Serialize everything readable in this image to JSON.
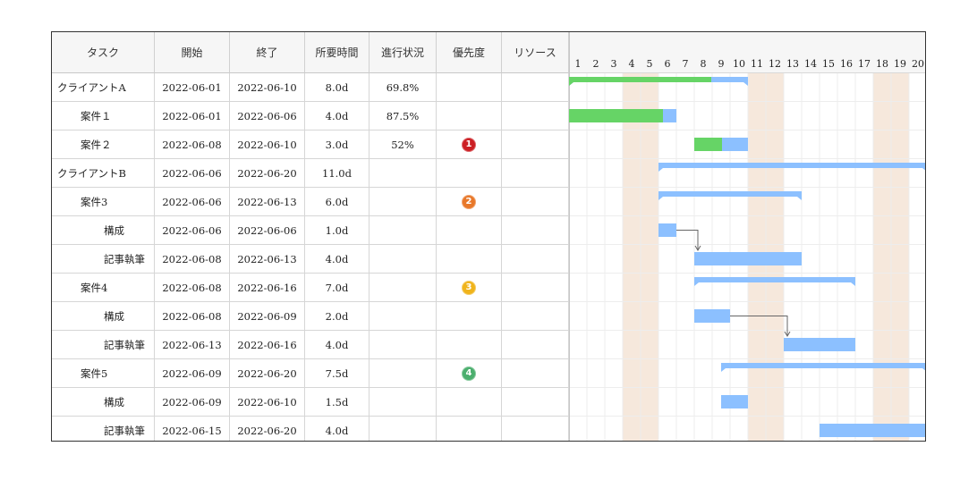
{
  "columns": {
    "task": "タスク",
    "start": "開始",
    "end": "終了",
    "duration": "所要時間",
    "progress": "進行状況",
    "priority": "優先度",
    "resource": "リソース"
  },
  "days": [
    "1",
    "2",
    "3",
    "4",
    "5",
    "6",
    "7",
    "8",
    "9",
    "10",
    "11",
    "12",
    "13",
    "14",
    "15",
    "16",
    "17",
    "18",
    "19",
    "20"
  ],
  "weekend_days": [
    4,
    5,
    11,
    12,
    18,
    19
  ],
  "priority_colors": {
    "1": "#cc1f24",
    "2": "#e8782a",
    "3": "#f0b41c",
    "4": "#4caf6e"
  },
  "bar_colors": {
    "planned": "#8cc0ff",
    "done": "#66d466",
    "link": "#666666"
  },
  "tasks": [
    {
      "name": "クライアントA",
      "level": 0,
      "start": "2022-06-01",
      "end": "2022-06-10",
      "duration": "8.0d",
      "progress": "69.8%",
      "priority": "",
      "resource": "",
      "group": true,
      "bar_start": 1,
      "bar_end": 10,
      "done_end": 7.95
    },
    {
      "name": "案件１",
      "level": 1,
      "start": "2022-06-01",
      "end": "2022-06-06",
      "duration": "4.0d",
      "progress": "87.5%",
      "priority": "",
      "resource": "",
      "group": false,
      "bar_start": 1,
      "bar_end": 6,
      "done_end": 6.25
    },
    {
      "name": "案件２",
      "level": 1,
      "start": "2022-06-08",
      "end": "2022-06-10",
      "duration": "3.0d",
      "progress": "52%",
      "priority": "1",
      "resource": "",
      "group": false,
      "bar_start": 8,
      "bar_end": 10,
      "done_end": 9.55
    },
    {
      "name": "クライアントB",
      "level": 0,
      "start": "2022-06-06",
      "end": "2022-06-20",
      "duration": "11.0d",
      "progress": "",
      "priority": "",
      "resource": "",
      "group": true,
      "bar_start": 6,
      "bar_end": 20
    },
    {
      "name": "案件3",
      "level": 1,
      "start": "2022-06-06",
      "end": "2022-06-13",
      "duration": "6.0d",
      "progress": "",
      "priority": "2",
      "resource": "",
      "group": true,
      "bar_start": 6,
      "bar_end": 13
    },
    {
      "name": "構成",
      "level": 2,
      "start": "2022-06-06",
      "end": "2022-06-06",
      "duration": "1.0d",
      "progress": "",
      "priority": "",
      "resource": "",
      "group": false,
      "bar_start": 6,
      "bar_end": 6
    },
    {
      "name": "記事執筆",
      "level": 2,
      "start": "2022-06-08",
      "end": "2022-06-13",
      "duration": "4.0d",
      "progress": "",
      "priority": "",
      "resource": "",
      "group": false,
      "bar_start": 8,
      "bar_end": 13
    },
    {
      "name": "案件4",
      "level": 1,
      "start": "2022-06-08",
      "end": "2022-06-16",
      "duration": "7.0d",
      "progress": "",
      "priority": "3",
      "resource": "",
      "group": true,
      "bar_start": 8,
      "bar_end": 16
    },
    {
      "name": "構成",
      "level": 2,
      "start": "2022-06-08",
      "end": "2022-06-09",
      "duration": "2.0d",
      "progress": "",
      "priority": "",
      "resource": "",
      "group": false,
      "bar_start": 8,
      "bar_end": 9
    },
    {
      "name": "記事執筆",
      "level": 2,
      "start": "2022-06-13",
      "end": "2022-06-16",
      "duration": "4.0d",
      "progress": "",
      "priority": "",
      "resource": "",
      "group": false,
      "bar_start": 13,
      "bar_end": 16
    },
    {
      "name": "案件5",
      "level": 1,
      "start": "2022-06-09",
      "end": "2022-06-20",
      "duration": "7.5d",
      "progress": "",
      "priority": "4",
      "resource": "",
      "group": true,
      "bar_start": 9.5,
      "bar_end": 20
    },
    {
      "name": "構成",
      "level": 2,
      "start": "2022-06-09",
      "end": "2022-06-10",
      "duration": "1.5d",
      "progress": "",
      "priority": "",
      "resource": "",
      "group": false,
      "bar_start": 9.5,
      "bar_end": 10
    },
    {
      "name": "記事執筆",
      "level": 2,
      "start": "2022-06-15",
      "end": "2022-06-20",
      "duration": "4.0d",
      "progress": "",
      "priority": "",
      "resource": "",
      "group": false,
      "bar_start": 15,
      "bar_end": 20
    }
  ],
  "links": [
    {
      "from": 5,
      "to": 6
    },
    {
      "from": 8,
      "to": 9
    }
  ]
}
